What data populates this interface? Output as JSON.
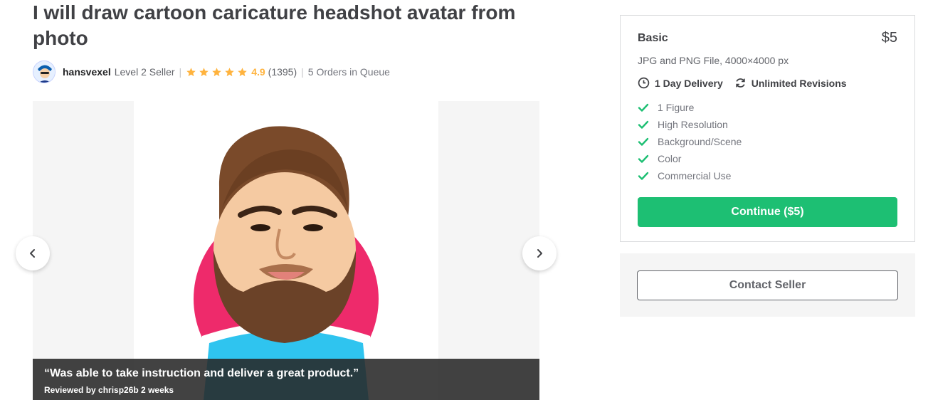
{
  "gig": {
    "title": "I will draw cartoon caricature headshot avatar from photo"
  },
  "seller": {
    "name": "hansvexel",
    "level": "Level 2 Seller",
    "rating": "4.9",
    "rating_stars": 5,
    "review_count": "(1395)",
    "orders_in_queue": "5 Orders in Queue"
  },
  "gallery": {
    "review_quote": "“Was able to take instruction and deliver a great product.”",
    "review_meta": "Reviewed by chrisp26b 2 weeks",
    "prev_icon": "chevron-left-icon",
    "next_icon": "chevron-right-icon"
  },
  "package": {
    "name": "Basic",
    "price": "$5",
    "description": "JPG and PNG File, 4000×4000 px",
    "delivery": "1 Day Delivery",
    "revisions": "Unlimited Revisions",
    "features": [
      "1 Figure",
      "High Resolution",
      "Background/Scene",
      "Color",
      "Commercial Use"
    ],
    "continue_label": "Continue ($5)"
  },
  "contact": {
    "label": "Contact Seller"
  },
  "colors": {
    "accent_green": "#1dbf73",
    "star_gold": "#ffb33e",
    "text_dark": "#404145"
  }
}
